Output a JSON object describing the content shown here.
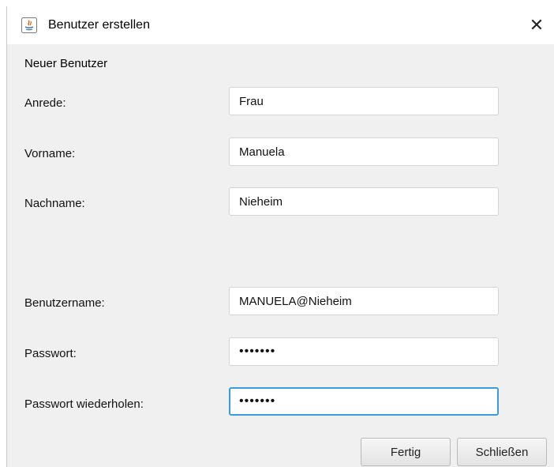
{
  "window": {
    "title": "Benutzer erstellen",
    "close_glyph": "✕",
    "app_icon": "java-icon"
  },
  "form": {
    "section_title": "Neuer Benutzer",
    "salutation": {
      "label": "Anrede:",
      "value": "Frau"
    },
    "first_name": {
      "label": "Vorname:",
      "value": "Manuela"
    },
    "last_name": {
      "label": "Nachname:",
      "value": "Nieheim"
    },
    "username": {
      "label": "Benutzername:",
      "value": "MANUELA@Nieheim"
    },
    "password": {
      "label": "Passwort:",
      "value": "•••••••"
    },
    "password_repeat": {
      "label": "Passwort wiederholen:",
      "value": "•••••••"
    }
  },
  "buttons": {
    "finish": "Fertig",
    "close": "Schließen"
  },
  "colors": {
    "focus_border": "#3b9be0",
    "window_background": "#f0f0f0"
  }
}
